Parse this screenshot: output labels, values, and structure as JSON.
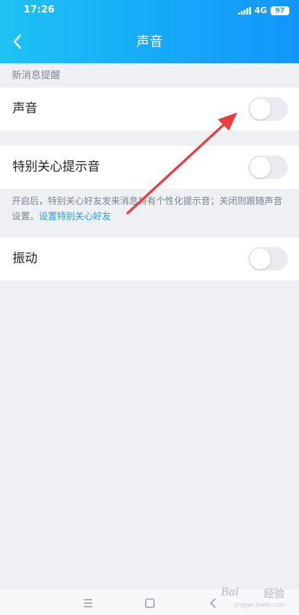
{
  "status_bar": {
    "time": "17:26",
    "network": "4G",
    "battery": "97"
  },
  "nav": {
    "title": "声音",
    "back_icon": "chevron-left-icon"
  },
  "section": {
    "label": "新消息提醒"
  },
  "settings": [
    {
      "label": "声音",
      "enabled": false
    },
    {
      "label": "特别关心提示音",
      "enabled": false
    },
    {
      "label": "振动",
      "enabled": false
    }
  ],
  "description": {
    "text": "开启后，特别关心好友发来消息将有个性化提示音；关闭则跟随声音设置。",
    "link": "设置特别关心好友"
  },
  "annotation": {
    "color": "#ee3b3b"
  },
  "system_nav": {
    "icons": [
      "menu-icon",
      "home-icon",
      "back-icon"
    ]
  },
  "watermark": {
    "brand": "Bai",
    "sub": "经验",
    "url": "jingyan.baidu.com"
  },
  "colors": {
    "header_start": "#1ec3f5",
    "header_end": "#1296fb",
    "link": "#1e9df5",
    "toggle_off": "#e9ebf1",
    "background": "#eef0f4"
  }
}
